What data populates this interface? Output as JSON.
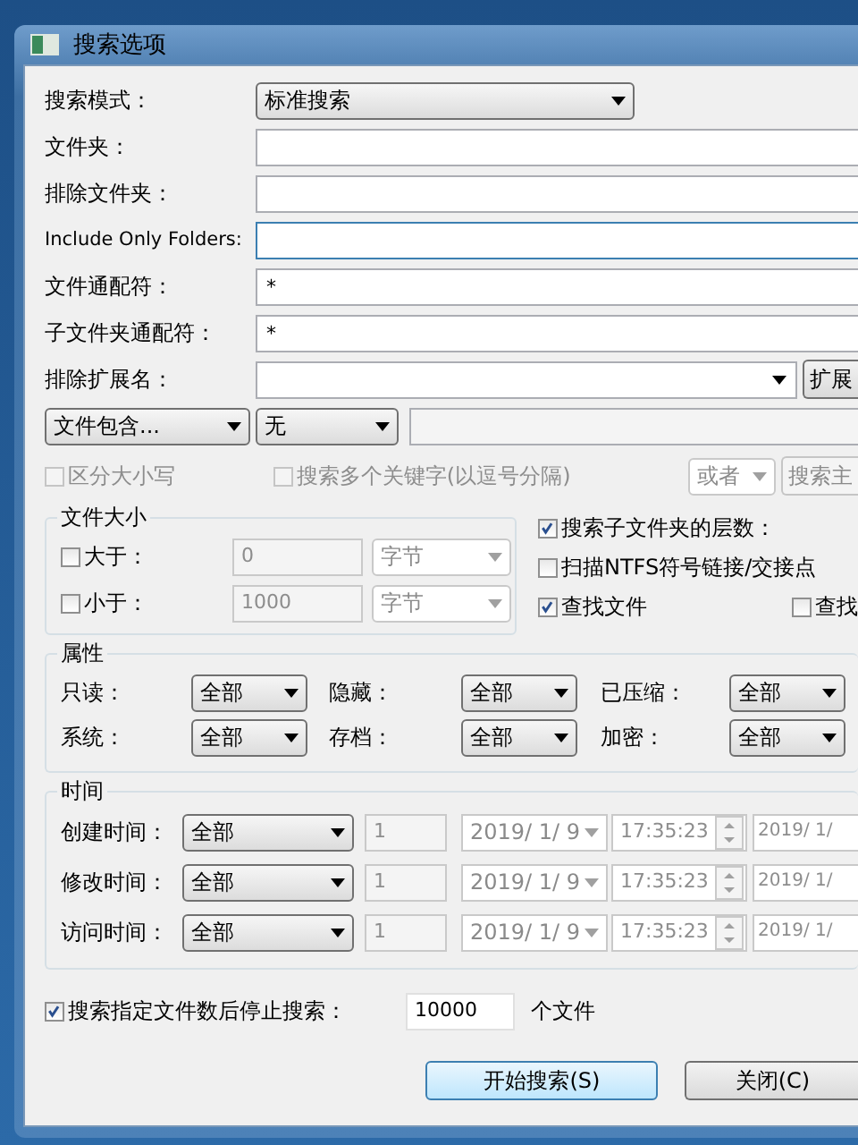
{
  "window": {
    "title": "搜索选项"
  },
  "search_mode": {
    "label": "搜索模式：",
    "value": "标准搜索"
  },
  "fields": [
    {
      "label": "文件夹："
    },
    {
      "label": "排除文件夹："
    },
    {
      "label": "Include Only Folders:",
      "focused": true
    },
    {
      "label": "文件通配符：",
      "value": "*",
      "focused": false
    },
    {
      "label": "子文件夹通配符：",
      "value": "*",
      "focused": false
    }
  ],
  "exclude_ext": {
    "label": "排除扩展名：",
    "button": "扩展"
  },
  "content_filter": {
    "type": "文件包含...",
    "encoding": "无"
  },
  "options": [
    {
      "label": "区分大小写",
      "checked": false,
      "disabled": true
    },
    {
      "label": "搜索多个关键字(以逗号分隔)",
      "checked": false,
      "disabled": true
    }
  ],
  "logic": {
    "value": "或者",
    "button": "搜索主",
    "disabled": true
  },
  "file_size": {
    "title": "文件大小",
    "rows": [
      {
        "label": "大于：",
        "checked": false,
        "value": "0",
        "unit": "字节"
      },
      {
        "label": "小于：",
        "checked": false,
        "value": "1000",
        "unit": "字节"
      }
    ]
  },
  "search_checks": [
    {
      "label": "搜索子文件夹的层数：",
      "checked": true
    },
    {
      "label": "扫描NTFS符号链接/交接点",
      "checked": false
    },
    {
      "label": "查找文件",
      "checked": true
    },
    {
      "label": "查找",
      "checked": false
    }
  ],
  "attributes": {
    "title": "属性",
    "items": [
      {
        "label": "只读：",
        "value": "全部"
      },
      {
        "label": "隐藏：",
        "value": "全部"
      },
      {
        "label": "已压缩：",
        "value": "全部"
      },
      {
        "label": "系统：",
        "value": "全部"
      },
      {
        "label": "存档：",
        "value": "全部"
      },
      {
        "label": "加密：",
        "value": "全部"
      }
    ]
  },
  "time": {
    "title": "时间",
    "rows": [
      {
        "label": "创建时间：",
        "mode": "全部",
        "count": "1",
        "date": "2019/ 1/ 9",
        "time": "17:35:23",
        "date_to": "2019/ 1/"
      },
      {
        "label": "修改时间：",
        "mode": "全部",
        "count": "1",
        "date": "2019/ 1/ 9",
        "time": "17:35:23",
        "date_to": "2019/ 1/"
      },
      {
        "label": "访问时间：",
        "mode": "全部",
        "count": "1",
        "date": "2019/ 1/ 9",
        "time": "17:35:23",
        "date_to": "2019/ 1/"
      }
    ]
  },
  "stop_limit": {
    "label": "搜索指定文件数后停止搜索：",
    "checked": true,
    "value": "10000",
    "suffix": "个文件"
  },
  "buttons": [
    {
      "label": "开始搜索(S)",
      "default": true
    },
    {
      "label": "关闭(C)",
      "default": false
    }
  ]
}
